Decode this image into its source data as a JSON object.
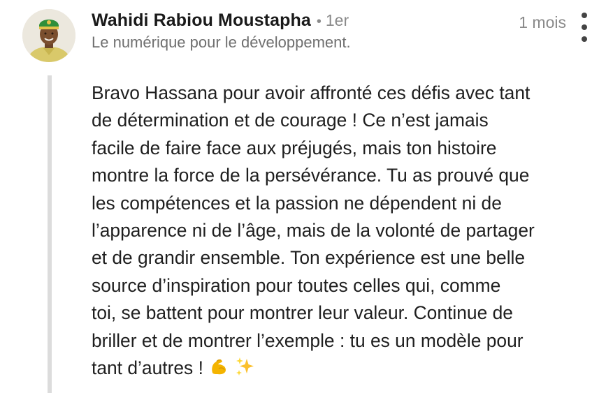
{
  "comment": {
    "author": "Wahidi Rabiou Moustapha",
    "separator": "•",
    "connection_degree": "1er",
    "headline": "Le numérique pour le développement.",
    "timestamp": "1 mois",
    "avatar_icon": "profile-photo",
    "menu_icon": "more-vert-icon",
    "body_lines": [
      "Bravo Hassana pour avoir affronté ces défis avec tant",
      "de détermination et de courage ! Ce n’est jamais",
      "facile de faire face aux préjugés, mais ton histoire",
      "montre la force de la persévérance. Tu as prouvé que",
      "les compétences et la passion ne dépendent ni de",
      "l’apparence ni de l’âge, mais de la volonté de partager",
      "et de grandir ensemble. Ton expérience est une belle",
      "source d’inspiration pour toutes celles qui, comme",
      "toi, se battent pour montrer leur valeur. Continue de",
      "briller et de montrer l’exemple : tu es un modèle pour",
      "tant d’autres !"
    ],
    "emojis": [
      "flexed-biceps-icon",
      "sparkles-icon"
    ]
  },
  "colors": {
    "text_primary": "#1f1f1f",
    "text_secondary": "#8a8a8a",
    "thread_line": "#dcdcdc"
  }
}
